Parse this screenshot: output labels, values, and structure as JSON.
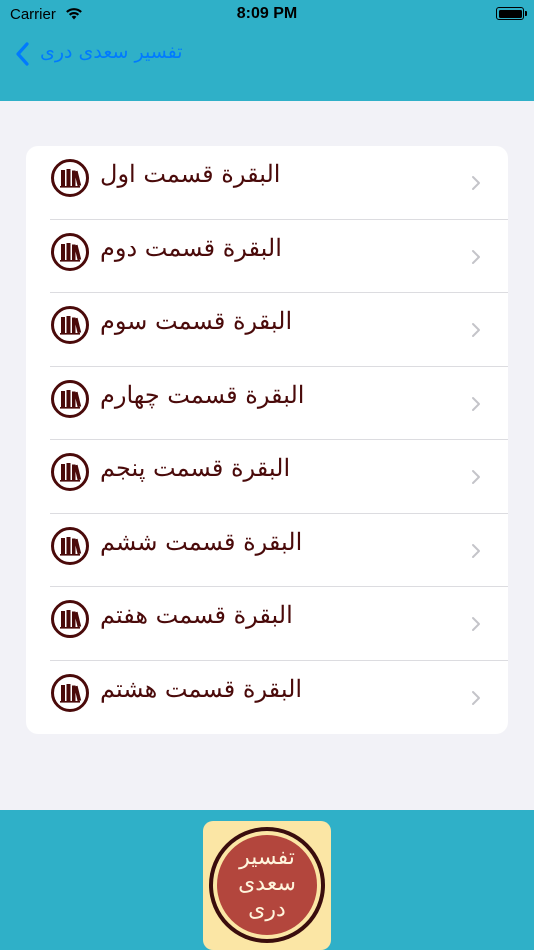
{
  "status_bar": {
    "carrier": "Carrier",
    "time": "8:09 PM",
    "battery_level": 1.0
  },
  "nav": {
    "title": "تفسیر سعدی دری",
    "back_icon": "chevron-left-icon"
  },
  "list": {
    "items": [
      {
        "label": "البقرة قسمت اول",
        "icon": "books-icon"
      },
      {
        "label": "البقرة قسمت دوم",
        "icon": "books-icon"
      },
      {
        "label": "البقرة قسمت سوم",
        "icon": "books-icon"
      },
      {
        "label": "البقرة قسمت چهارم",
        "icon": "books-icon"
      },
      {
        "label": "البقرة قسمت پنجم",
        "icon": "books-icon"
      },
      {
        "label": "البقرة قسمت ششم",
        "icon": "books-icon"
      },
      {
        "label": "البقرة قسمت هفتم",
        "icon": "books-icon"
      },
      {
        "label": "البقرة قسمت هشتم",
        "icon": "books-icon"
      }
    ]
  },
  "logo": {
    "line1": "تفسیر",
    "line2": "سعدی",
    "line3": "دری"
  },
  "colors": {
    "bar": "#2fb0c8",
    "nav_link": "#007aff",
    "label_text": "#4a0a0a",
    "icon": "#4a0a0a",
    "logo_bg": "#fbe6a5",
    "logo_circle": "#b3463d"
  }
}
